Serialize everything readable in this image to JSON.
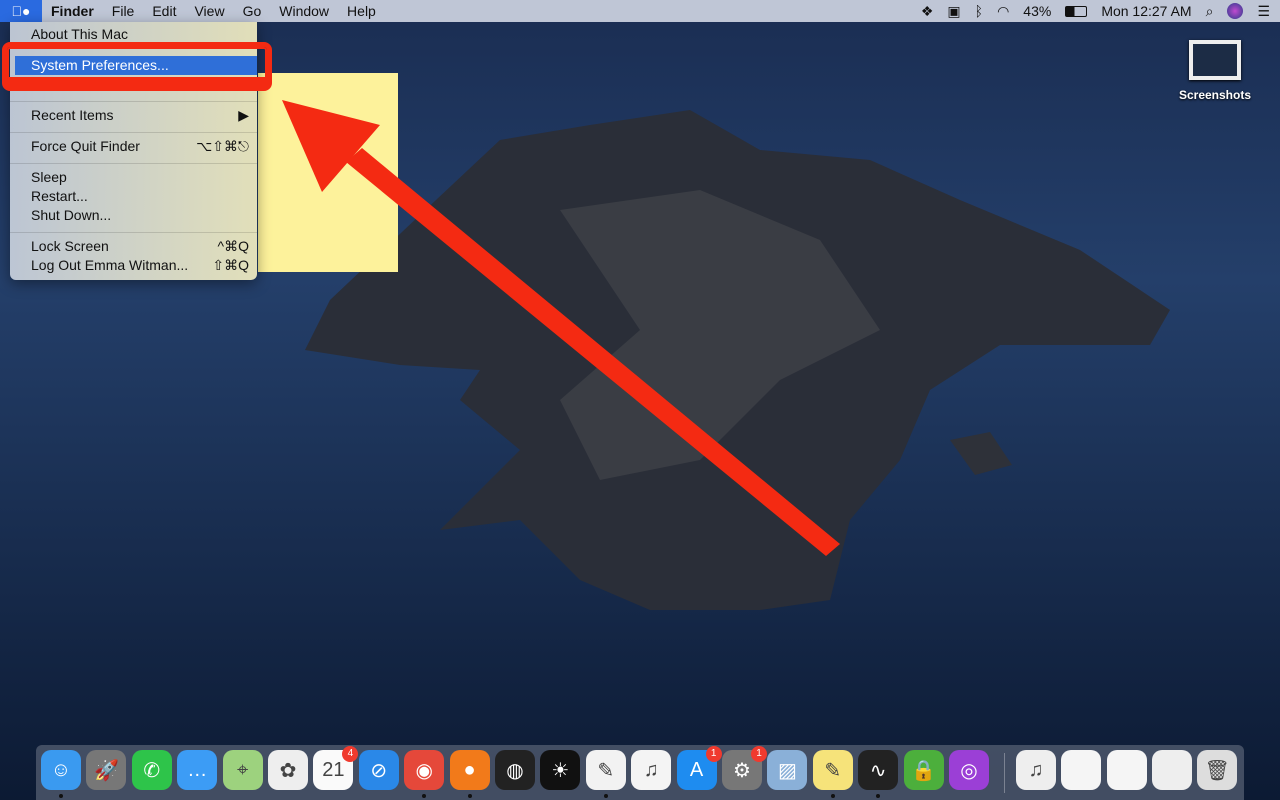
{
  "menubar": {
    "apple": "",
    "app": "Finder",
    "items": [
      "File",
      "Edit",
      "View",
      "Go",
      "Window",
      "Help"
    ],
    "battery": "43%",
    "clock": "Mon 12:27 AM"
  },
  "apple_menu": {
    "items": [
      {
        "label": "About This Mac",
        "shortcut": ""
      },
      {
        "label": "System Preferences...",
        "shortcut": "",
        "highlighted": true
      },
      {
        "label": "Recent Items",
        "shortcut": "▶"
      },
      {
        "label": "Force Quit Finder",
        "shortcut": "⌥⇧⌘⎋"
      },
      {
        "label": "Sleep",
        "shortcut": ""
      },
      {
        "label": "Restart...",
        "shortcut": ""
      },
      {
        "label": "Shut Down...",
        "shortcut": ""
      },
      {
        "label": "Lock Screen",
        "shortcut": "^⌘Q"
      },
      {
        "label": "Log Out Emma Witman...",
        "shortcut": "⇧⌘Q"
      }
    ]
  },
  "desktop": {
    "icon_label": "Screenshots"
  },
  "annotation": {
    "color": "#f42a12"
  },
  "dock": {
    "apps": [
      {
        "name": "finder",
        "color": "#3a9af0",
        "glyph": "☺",
        "running": true
      },
      {
        "name": "launchpad",
        "color": "#777",
        "glyph": "🚀"
      },
      {
        "name": "facetime",
        "color": "#2ec44a",
        "glyph": "✆"
      },
      {
        "name": "messages",
        "color": "#3c9cf5",
        "glyph": "…"
      },
      {
        "name": "maps",
        "color": "#9dd27e",
        "glyph": "⌖"
      },
      {
        "name": "photos",
        "color": "#eee",
        "glyph": "✿"
      },
      {
        "name": "calendar",
        "color": "#fafafa",
        "glyph": "21",
        "badge": "4"
      },
      {
        "name": "safari",
        "color": "#2a88e8",
        "glyph": "⊘"
      },
      {
        "name": "chrome",
        "color": "#e5483a",
        "glyph": "◉",
        "running": true
      },
      {
        "name": "firefox",
        "color": "#f27a1a",
        "glyph": "●",
        "running": true
      },
      {
        "name": "siri",
        "color": "#222",
        "glyph": "◍"
      },
      {
        "name": "brightness",
        "color": "#111",
        "glyph": "☀"
      },
      {
        "name": "textedit",
        "color": "#f2f2f2",
        "glyph": "✎",
        "running": true
      },
      {
        "name": "music",
        "color": "#f4f4f4",
        "glyph": "♫"
      },
      {
        "name": "app-store",
        "color": "#1e8cf0",
        "glyph": "A",
        "badge": "1"
      },
      {
        "name": "system-preferences",
        "color": "#777",
        "glyph": "⚙",
        "badge": "1"
      },
      {
        "name": "preview",
        "color": "#8ab0d8",
        "glyph": "▨"
      },
      {
        "name": "stickies",
        "color": "#f6e37a",
        "glyph": "✎",
        "running": true
      },
      {
        "name": "activity-monitor",
        "color": "#222",
        "glyph": "∿",
        "running": true
      },
      {
        "name": "private-internet-access",
        "color": "#4caf3c",
        "glyph": "🔒"
      },
      {
        "name": "podcasts",
        "color": "#9b3fd6",
        "glyph": "◎"
      }
    ],
    "docs": [
      {
        "name": "music-folder",
        "color": "#eee",
        "glyph": "♫"
      },
      {
        "name": "document-1",
        "color": "#f5f5f5",
        "glyph": ""
      },
      {
        "name": "document-2",
        "color": "#f5f5f5",
        "glyph": ""
      },
      {
        "name": "document-3",
        "color": "#eee",
        "glyph": ""
      },
      {
        "name": "trash",
        "color": "#ddd",
        "glyph": "🗑"
      }
    ]
  }
}
